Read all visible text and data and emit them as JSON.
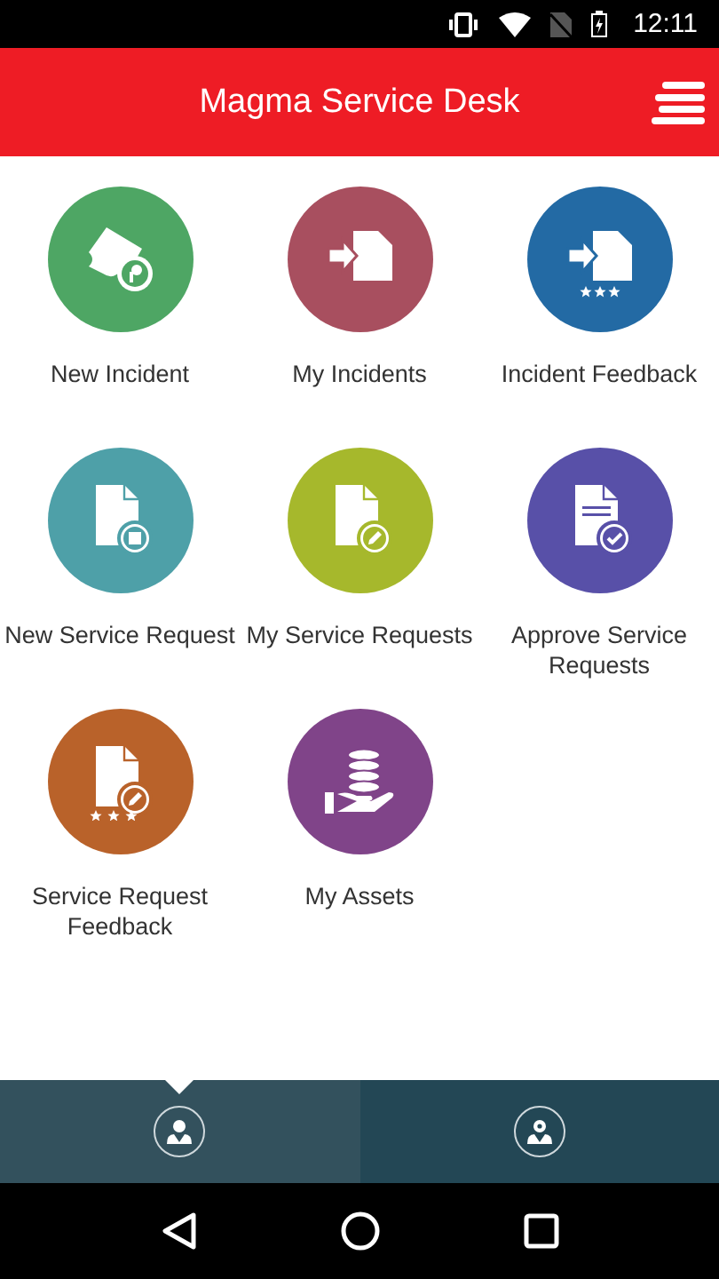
{
  "status_bar": {
    "time": "12:11"
  },
  "header": {
    "title": "Magma Service Desk"
  },
  "tiles": [
    {
      "label": "New Incident",
      "kind": "ticket",
      "color": "#4ea664"
    },
    {
      "label": "My Incidents",
      "kind": "arrow-doc",
      "color": "#a84f5f"
    },
    {
      "label": "Incident Feedback",
      "kind": "arrow-doc-stars",
      "color": "#236aa4"
    },
    {
      "label": "New Service Request",
      "kind": "doc-list",
      "color": "#4ea0a8"
    },
    {
      "label": "My Service Requests",
      "kind": "doc-edit",
      "color": "#a6b82c"
    },
    {
      "label": "Approve Service Requests",
      "kind": "doc-check",
      "color": "#5850a8"
    },
    {
      "label": "Service Request Feedback",
      "kind": "doc-edit-stars",
      "color": "#b9622a"
    },
    {
      "label": "My Assets",
      "kind": "assets",
      "color": "#804489"
    }
  ],
  "tabs": [
    {
      "kind": "user",
      "selected": true
    },
    {
      "kind": "user-gear",
      "selected": false
    }
  ]
}
